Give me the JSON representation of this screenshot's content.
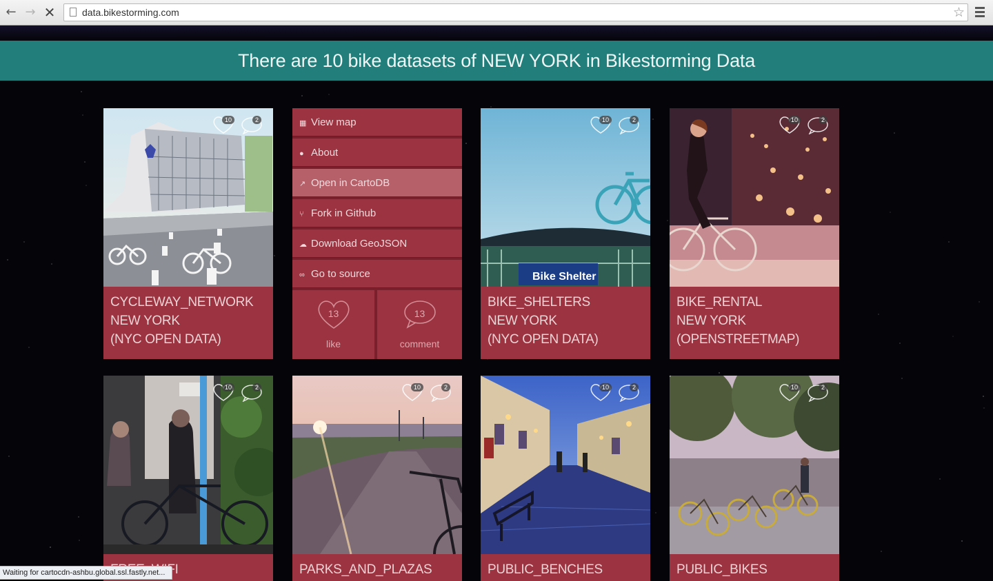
{
  "browser": {
    "url": "data.bikestorming.com",
    "status": "Waiting for cartocdn-ashbu.global.ssl.fastly.net..."
  },
  "banner": {
    "text": "There are 10 bike datasets of NEW YORK in Bikestorming Data"
  },
  "colors": {
    "banner": "#217e7a",
    "card": "#9b3340",
    "background": "#000000"
  },
  "cards": [
    {
      "lines": [
        "CYCLEWAY_NETWORK",
        "NEW YORK",
        "(NYC OPEN DATA)"
      ],
      "likes": "10",
      "comments": "2"
    },
    {
      "lines": [
        "BIKE_SHELTERS",
        "NEW YORK",
        "(NYC OPEN DATA)"
      ],
      "likes": "10",
      "comments": "2"
    },
    {
      "lines": [
        "BIKE_RENTAL",
        "NEW YORK",
        "(OPENSTREETMAP)"
      ],
      "likes": "10",
      "comments": "2"
    },
    {
      "lines": [
        "FREE_WIFI"
      ],
      "likes": "10",
      "comments": "2"
    },
    {
      "lines": [
        "PARKS_AND_PLAZAS"
      ],
      "likes": "10",
      "comments": "2"
    },
    {
      "lines": [
        "PUBLIC_BENCHES"
      ],
      "likes": "10",
      "comments": "2"
    },
    {
      "lines": [
        "PUBLIC_BIKES"
      ],
      "likes": "10",
      "comments": "2"
    }
  ],
  "menu": {
    "items": [
      {
        "label": "View map",
        "icon": "map-icon"
      },
      {
        "label": "About",
        "icon": "info-icon"
      },
      {
        "label": "Open in CartoDB",
        "icon": "share-arrow-icon"
      },
      {
        "label": "Fork in Github",
        "icon": "fork-icon"
      },
      {
        "label": "Download GeoJSON",
        "icon": "cloud-download-icon"
      },
      {
        "label": "Go to source",
        "icon": "link-icon"
      }
    ],
    "like": {
      "count": "13",
      "label": "like"
    },
    "comment": {
      "count": "13",
      "label": "comment"
    }
  }
}
